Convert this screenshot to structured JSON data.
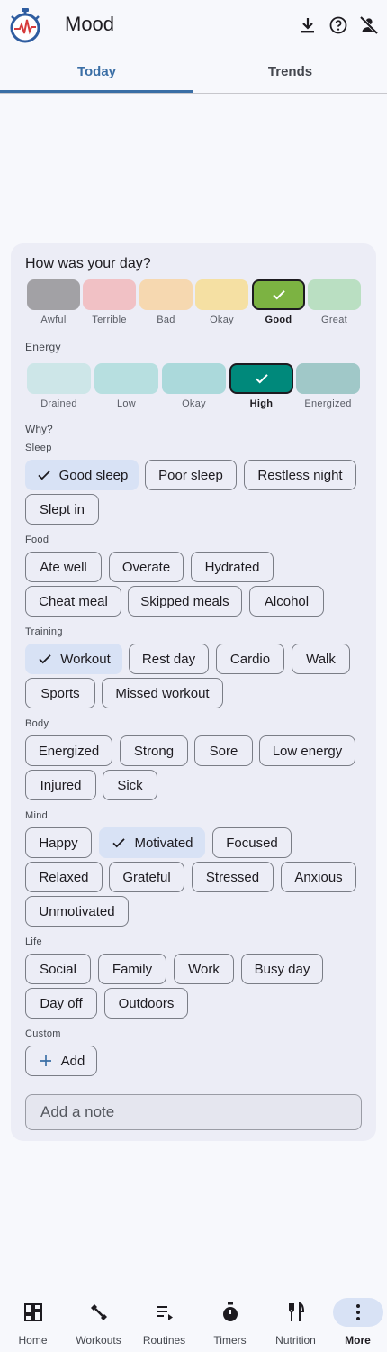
{
  "app": {
    "title": "Mood"
  },
  "header_icons": [
    "download-icon",
    "help-icon",
    "account-off-icon"
  ],
  "tabs": [
    {
      "label": "Today",
      "active": true
    },
    {
      "label": "Trends",
      "active": false
    }
  ],
  "mood": {
    "question": "How was your day?",
    "options": [
      {
        "label": "Awful",
        "color": "#a2a1a5"
      },
      {
        "label": "Terrible",
        "color": "#f1c1c5"
      },
      {
        "label": "Bad",
        "color": "#f6d8b0"
      },
      {
        "label": "Okay",
        "color": "#f5e0a3"
      },
      {
        "label": "Good",
        "color": "#7cb342",
        "selected": true
      },
      {
        "label": "Great",
        "color": "#badfc2"
      }
    ]
  },
  "energy": {
    "title": "Energy",
    "options": [
      {
        "label": "Drained",
        "color": "#cde6e8"
      },
      {
        "label": "Low",
        "color": "#b7dfe0"
      },
      {
        "label": "Okay",
        "color": "#abd9db"
      },
      {
        "label": "High",
        "color": "#00897b",
        "selected": true
      },
      {
        "label": "Energized",
        "color": "#a0c8c8"
      }
    ]
  },
  "why": {
    "title": "Why?",
    "groups": [
      {
        "title": "Sleep",
        "chips": [
          {
            "label": "Good sleep",
            "selected": true
          },
          {
            "label": "Poor sleep"
          },
          {
            "label": "Restless night"
          },
          {
            "label": "Slept in"
          }
        ]
      },
      {
        "title": "Food",
        "chips": [
          {
            "label": "Ate well"
          },
          {
            "label": "Overate"
          },
          {
            "label": "Hydrated"
          },
          {
            "label": "Cheat meal"
          },
          {
            "label": "Skipped meals"
          },
          {
            "label": "Alcohol"
          }
        ]
      },
      {
        "title": "Training",
        "chips": [
          {
            "label": "Workout",
            "selected": true
          },
          {
            "label": "Rest day"
          },
          {
            "label": "Cardio"
          },
          {
            "label": "Walk"
          },
          {
            "label": "Sports"
          },
          {
            "label": "Missed workout"
          }
        ]
      },
      {
        "title": "Body",
        "chips": [
          {
            "label": "Energized"
          },
          {
            "label": "Strong"
          },
          {
            "label": "Sore"
          },
          {
            "label": "Low energy"
          },
          {
            "label": "Injured"
          },
          {
            "label": "Sick"
          }
        ]
      },
      {
        "title": "Mind",
        "chips": [
          {
            "label": "Happy"
          },
          {
            "label": "Motivated",
            "selected": true
          },
          {
            "label": "Focused"
          },
          {
            "label": "Relaxed"
          },
          {
            "label": "Grateful"
          },
          {
            "label": "Stressed"
          },
          {
            "label": "Anxious"
          },
          {
            "label": "Unmotivated"
          }
        ]
      },
      {
        "title": "Life",
        "chips": [
          {
            "label": "Social"
          },
          {
            "label": "Family"
          },
          {
            "label": "Work"
          },
          {
            "label": "Busy day"
          },
          {
            "label": "Day off"
          },
          {
            "label": "Outdoors"
          }
        ]
      }
    ],
    "custom": {
      "title": "Custom",
      "add_label": "Add"
    }
  },
  "note": {
    "placeholder": "Add a note"
  },
  "bottom_nav": [
    {
      "label": "Home",
      "icon": "dashboard-icon"
    },
    {
      "label": "Workouts",
      "icon": "dumbbell-icon"
    },
    {
      "label": "Routines",
      "icon": "playlist-icon"
    },
    {
      "label": "Timers",
      "icon": "stopwatch-icon"
    },
    {
      "label": "Nutrition",
      "icon": "restaurant-icon"
    },
    {
      "label": "More",
      "icon": "more-vert-icon",
      "active": true
    }
  ],
  "colors": {
    "accent": "#3a6ea5",
    "selected_chip": "#d8e2f5",
    "card": "#ecedf6"
  }
}
